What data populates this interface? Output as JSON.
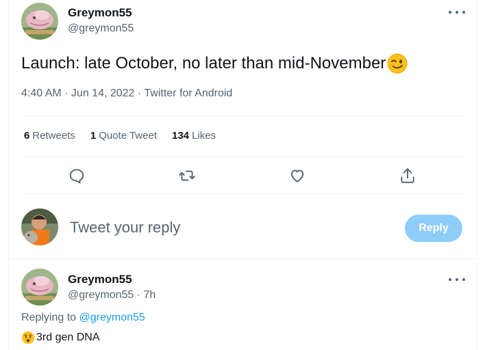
{
  "main_tweet": {
    "author_name": "Greymon55",
    "author_handle": "@greymon55",
    "text": "Launch: late October, no later than mid-November",
    "emoji": "winking-face-emoji",
    "meta": "4:40 AM · Jun 14, 2022 · Twitter for Android",
    "stats": {
      "retweets_count": "6",
      "retweets_label": "Retweets",
      "quotes_count": "1",
      "quotes_label": "Quote Tweet",
      "likes_count": "134",
      "likes_label": "Likes"
    },
    "actions": [
      "reply-icon",
      "retweet-icon",
      "like-icon",
      "share-icon"
    ]
  },
  "composer": {
    "placeholder": "Tweet your reply",
    "reply_button": "Reply"
  },
  "reply_tweet": {
    "author_name": "Greymon55",
    "author_handle": "@greymon55 · 7h",
    "replying_prefix": "Replying to",
    "replying_to": "@greymon55",
    "emoji": "hushed-face-emoji",
    "text": "3rd gen DNA"
  },
  "colors": {
    "accent": "#1d9bf0",
    "reply_button": "#8ecdf8",
    "secondary_text": "#536471",
    "divider": "#eff3f4"
  }
}
